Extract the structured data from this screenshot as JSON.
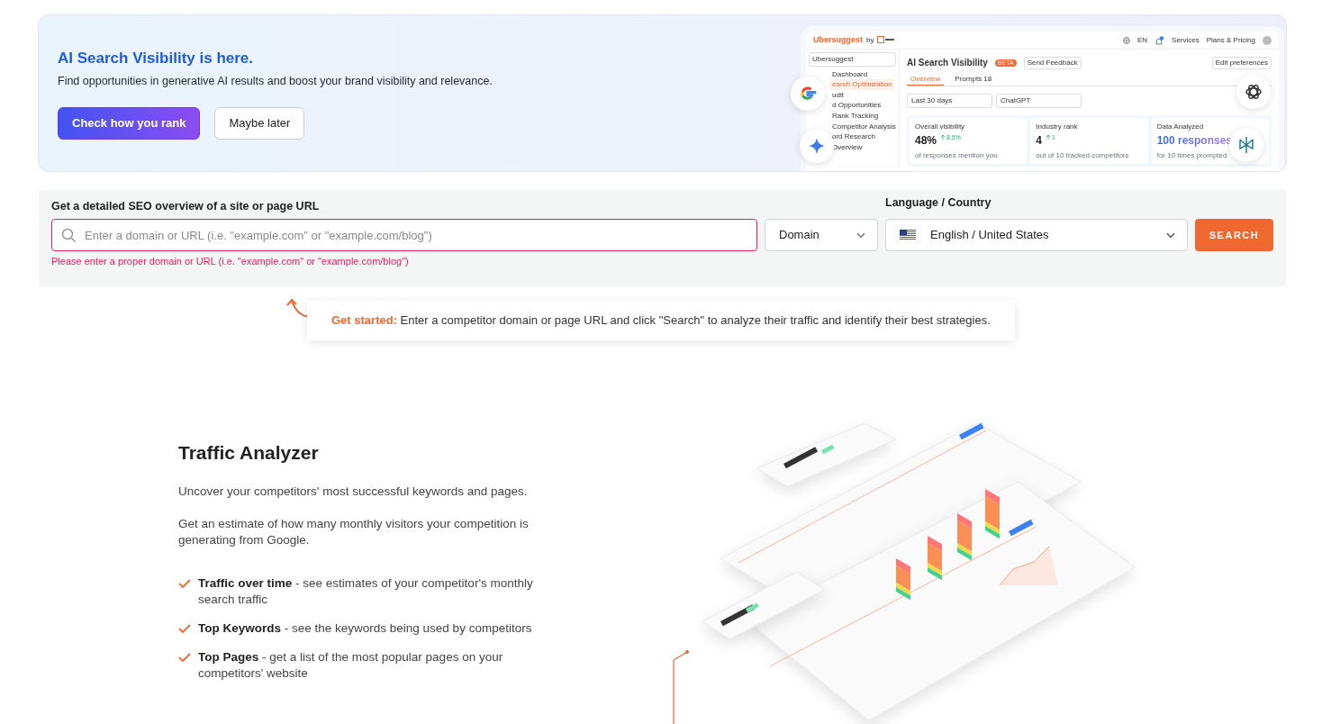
{
  "banner": {
    "title": "AI Search Visibility is here.",
    "subtitle": "Find opportunities in generative AI results and boost your brand visibility and relevance.",
    "buttons": [
      {
        "label": "Check how you rank",
        "kind": "primary"
      },
      {
        "label": "Maybe later",
        "kind": "secondary"
      }
    ],
    "preview": {
      "brand": "Ubersuggest",
      "brand_by": "by",
      "header_links": [
        "EN",
        "Services",
        "Plans & Pricing"
      ],
      "project": "Ubersuggest",
      "sidebar": [
        {
          "label": "Dashboard",
          "selected": false
        },
        {
          "label": "earch Optimization",
          "selected": true
        },
        {
          "label": "udit",
          "selected": false
        },
        {
          "label": "d Opportunities",
          "selected": false
        },
        {
          "label": "Rank Tracking",
          "selected": false
        },
        {
          "label": "Competitor Analysis",
          "selected": false
        },
        {
          "label": "ord Research",
          "selected": false
        },
        {
          "label": "Overview",
          "selected": false
        }
      ],
      "title": "AI Search Visibility",
      "badge": "BETA",
      "feedback": "Send Feedback",
      "preferences": "Edit preferences",
      "tabs": [
        {
          "label": "Overview",
          "selected": true
        },
        {
          "label": "Prompts",
          "count": "18",
          "selected": false
        }
      ],
      "filters": [
        "Last 30 days",
        "ChatGPT"
      ],
      "cards": [
        {
          "label": "Overall visibility",
          "value": "48%",
          "change": "8.5%",
          "note": "of responses mention you",
          "kind": "plain"
        },
        {
          "label": "Industry rank",
          "value": "4",
          "change": "1",
          "note": "out of 10 tracked competitors",
          "kind": "plain"
        },
        {
          "label": "Data Analyzed",
          "value": "100 responses",
          "note": "for 10 times prompted",
          "kind": "gradient"
        }
      ]
    }
  },
  "search": {
    "label": "Get a detailed SEO overview of a site or page URL",
    "placeholder": "Enter a domain or URL (i.e. \"example.com\" or \"example.com/blog\")",
    "invalid": true,
    "error": "Please enter a proper domain or URL (i.e. \"example.com\" or \"example.com/blog\")",
    "type_select": "Domain",
    "language_label": "Language / Country",
    "language": "English / United States",
    "button": "SEARCH"
  },
  "tip": "**Get started:** Enter a competitor domain or page URL and click \"Search\" to analyze their traffic and identify their best strategies.",
  "feature": {
    "title": "Traffic Analyzer",
    "paragraphs": [
      "Uncover your competitors' most successful keywords and pages.",
      "Get an estimate of how many monthly visitors your competition is generating from Google."
    ],
    "bullets": [
      "**Traffic over time** - see estimates of your competitor's monthly search traffic",
      "**Top Keywords** - see the keywords being used by competitors",
      "**Top Pages** - get a list of the most popular pages on your competitors' website"
    ]
  }
}
